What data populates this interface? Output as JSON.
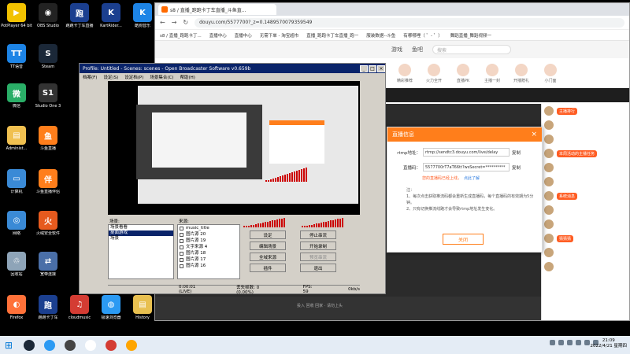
{
  "desktop": {
    "icons": [
      {
        "label": "PotPlayer 64 bit",
        "color": "#f2c200",
        "glyph": "▶"
      },
      {
        "label": "OBS Studio",
        "color": "#222222",
        "glyph": "◉"
      },
      {
        "label": "跑跑卡丁车直播",
        "color": "#1b3f8f",
        "glyph": "跑"
      },
      {
        "label": "KartRider...",
        "color": "#1b3f8f",
        "glyph": "K"
      },
      {
        "label": "酷狗音乐",
        "color": "#1d84e6",
        "glyph": "K"
      },
      {
        "label": "TT语音",
        "color": "#1d84e6",
        "glyph": "TT"
      },
      {
        "label": "Steam",
        "color": "#1b2838",
        "glyph": "S"
      },
      {
        "label": "微信",
        "color": "#2aae67",
        "glyph": "微"
      },
      {
        "label": "Studio One 3",
        "color": "#333333",
        "glyph": "S1"
      },
      {
        "label": "Administ...",
        "color": "#f0c050",
        "glyph": "▤"
      },
      {
        "label": "斗鱼直播",
        "color": "#ff7e1b",
        "glyph": "鱼"
      },
      {
        "label": "计算机",
        "color": "#3a8ad6",
        "glyph": "▭"
      },
      {
        "label": "斗鱼直播伴侣",
        "color": "#ff7e1b",
        "glyph": "伴"
      },
      {
        "label": "网络",
        "color": "#3a8ad6",
        "glyph": "◎"
      },
      {
        "label": "火绒安全软件",
        "color": "#e65a1e",
        "glyph": "火"
      },
      {
        "label": "回收站",
        "color": "#8ea4b8",
        "glyph": "♲"
      },
      {
        "label": "宽带连接",
        "color": "#4a6fa8",
        "glyph": "⇄"
      },
      {
        "label": "Firefox",
        "color": "#ff7139",
        "glyph": "◐"
      },
      {
        "label": "跑跑卡丁车",
        "color": "#1b3f8f",
        "glyph": "跑"
      },
      {
        "label": "cloudmusic",
        "color": "#d43c33",
        "glyph": "♫"
      },
      {
        "label": "极速浏览器",
        "color": "#2b9af3",
        "glyph": "◍"
      },
      {
        "label": "History",
        "color": "#e8c050",
        "glyph": "▤"
      }
    ]
  },
  "browser": {
    "tab_title": "s8 / 直播_跑跑卡丁车直播_斗鱼直...",
    "url": "douyu.com/5577700?_z=0.1489570079359549",
    "bookmarks": [
      "s8 / 直播_跑跑卡丁...",
      "直播中心",
      "直播中心",
      "无需下单 - 淘宝超市",
      "直播_跑跑卡丁车直播_跑一",
      "服装数据--斗鱼",
      "有哪哪哩（ ゜- ゜）",
      "舞蹈直播_舞蹈视频一"
    ],
    "nav": [
      "游戏",
      "鱼吧"
    ],
    "search_placeholder": "搜索",
    "categories": [
      "精彩推荐",
      "火力全开",
      "直播PK",
      "主播一封",
      "开播赠礼",
      "小门面"
    ],
    "player_footer": "投入 回收 回家 · 请勿上头",
    "right_badges": [
      "主播排行",
      "本周活动的主播任务",
      "系统消息",
      "猜猜猜"
    ]
  },
  "dialog": {
    "title": "直播信息",
    "close_glyph": "×",
    "rtmp_label": "rtmp地址：",
    "rtmp_value": "rtmp://sendtc3.douyu.com/live/delay",
    "stream_label": "直播码：",
    "stream_value": "5577700rT7aT66tt?wsSecret=**********",
    "copy_label": "复制",
    "warn_text": "您的直播码已经上线，",
    "warn_link": "点此了解",
    "notes_title": "注：",
    "notes": [
      "1、每次点击获取推流码都会重新生成直播码，每个直播码的有效期为5分钟。",
      "2、只有切换推流线路才会导致rtmp地址发生变化。"
    ],
    "ok_label": "关闭"
  },
  "obs": {
    "title": "Profile: Untitled - Scenes: scenes - Open Broadcaster Software v0.659b",
    "menu": [
      "档案(F)",
      "设定(S)",
      "设定档(P)",
      "场景集合(C)",
      "帮助(H)"
    ],
    "scenes_label": "场景:",
    "scenes": [
      "场景看看",
      "桌面游戏",
      "场景"
    ],
    "selected_scene": 1,
    "sources_label": "来源:",
    "sources": [
      "music_title",
      "图片源 20",
      "图片源 19",
      "文字来源 4",
      "图片源 18",
      "图片源 17",
      "图片源 16"
    ],
    "buttons": {
      "settings": "设定",
      "stop_stream": "停止串流",
      "edit_scene": "编辑场景",
      "start_record": "开始录制",
      "fullscreen": "全域来源",
      "preview": "预览串流",
      "plugins": "插件",
      "exit": "退出"
    },
    "status": {
      "time": "0:00:01 (LIVE)",
      "dropped": "丢失帧数: 0 (0.00%)",
      "fps": "FPS: 59",
      "kbps": "0kb/s"
    }
  },
  "taskbar": {
    "start_glyph": "⊞",
    "apps": [
      "#1b2838",
      "#2b9af3",
      "#444444",
      "#fff",
      "#d43c33",
      "#ffa500"
    ],
    "time": "21:09",
    "date": "2022/4/21 星期四"
  }
}
